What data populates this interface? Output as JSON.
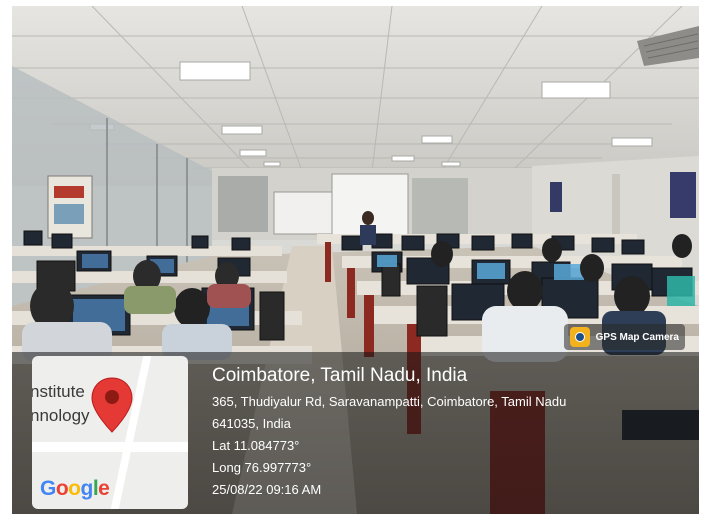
{
  "photo": {
    "description_icon": "classroom-photo"
  },
  "badge": {
    "icon": "gps-map-camera-icon",
    "label": "GPS Map Camera"
  },
  "map": {
    "label_line1": "nstitute",
    "label_line2": "nnology",
    "pin_icon": "map-pin-icon",
    "logo_letters": [
      "G",
      "o",
      "o",
      "g",
      "l",
      "e"
    ],
    "logo_colors": [
      "#4285F4",
      "#EA4335",
      "#FBBC05",
      "#4285F4",
      "#34A853",
      "#EA4335"
    ]
  },
  "location": {
    "title": "Coimbatore, Tamil Nadu, India",
    "address_line1": "365, Thudiyalur Rd, Saravanampatti, Coimbatore, Tamil Nadu",
    "address_line2": "641035, India",
    "lat": "Lat 11.084773°",
    "long": "Long 76.997773°",
    "datetime": "25/08/22 09:16 AM"
  }
}
